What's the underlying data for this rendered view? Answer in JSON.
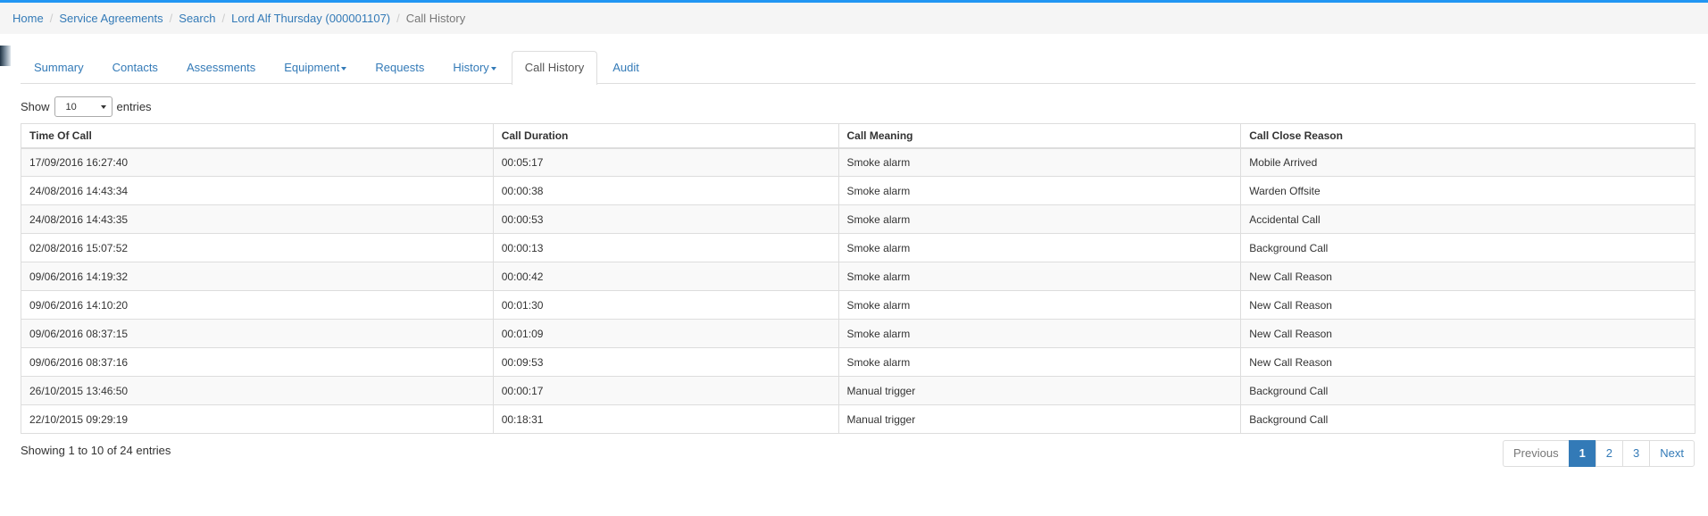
{
  "breadcrumb": {
    "items": [
      "Home",
      "Service Agreements",
      "Search",
      "Lord Alf Thursday (000001107)"
    ],
    "current": "Call History"
  },
  "tabs": [
    {
      "label": "Summary"
    },
    {
      "label": "Contacts"
    },
    {
      "label": "Assessments"
    },
    {
      "label": "Equipment"
    },
    {
      "label": "Requests"
    },
    {
      "label": "History"
    },
    {
      "label": "Call History"
    },
    {
      "label": "Audit"
    }
  ],
  "length": {
    "show_label": "Show",
    "selected": "10",
    "entries_label": "entries"
  },
  "table": {
    "headers": [
      "Time Of Call",
      "Call Duration",
      "Call Meaning",
      "Call Close Reason"
    ],
    "rows": [
      [
        "17/09/2016 16:27:40",
        "00:05:17",
        "Smoke alarm",
        "Mobile Arrived"
      ],
      [
        "24/08/2016 14:43:34",
        "00:00:38",
        "Smoke alarm",
        "Warden Offsite"
      ],
      [
        "24/08/2016 14:43:35",
        "00:00:53",
        "Smoke alarm",
        "Accidental Call"
      ],
      [
        "02/08/2016 15:07:52",
        "00:00:13",
        "Smoke alarm",
        "Background Call"
      ],
      [
        "09/06/2016 14:19:32",
        "00:00:42",
        "Smoke alarm",
        "New Call Reason"
      ],
      [
        "09/06/2016 14:10:20",
        "00:01:30",
        "Smoke alarm",
        "New Call Reason"
      ],
      [
        "09/06/2016 08:37:15",
        "00:01:09",
        "Smoke alarm",
        "New Call Reason"
      ],
      [
        "09/06/2016 08:37:16",
        "00:09:53",
        "Smoke alarm",
        "New Call Reason"
      ],
      [
        "26/10/2015 13:46:50",
        "00:00:17",
        "Manual trigger",
        "Background Call"
      ],
      [
        "22/10/2015 09:29:19",
        "00:18:31",
        "Manual trigger",
        "Background Call"
      ]
    ]
  },
  "info": "Showing 1 to 10 of 24 entries",
  "pagination": {
    "previous": "Previous",
    "pages": [
      "1",
      "2",
      "3"
    ],
    "next": "Next"
  }
}
